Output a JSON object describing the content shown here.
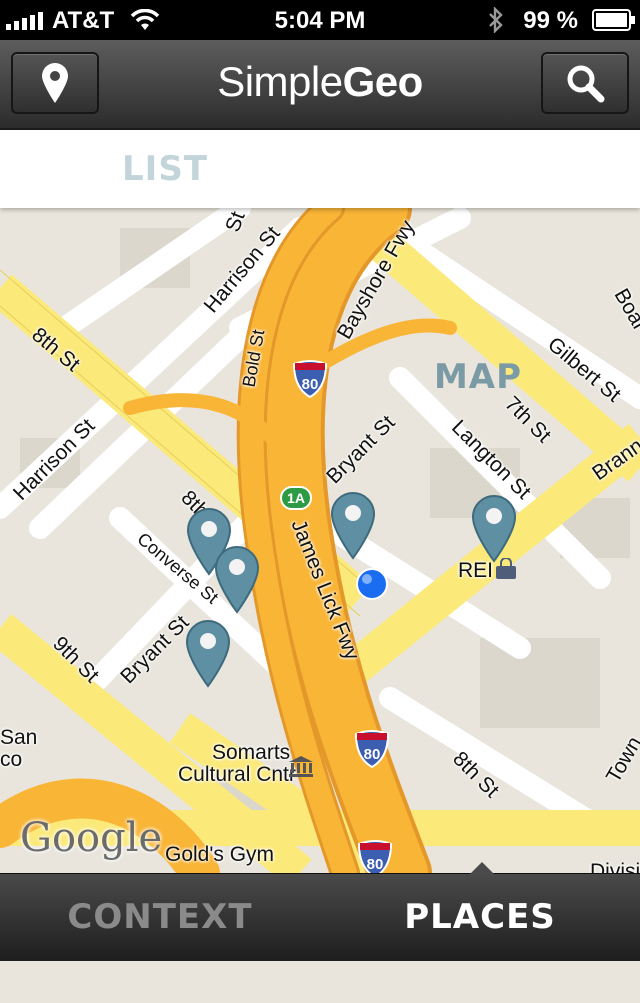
{
  "status_bar": {
    "carrier": "AT&T",
    "time": "5:04 PM",
    "battery": "99 %"
  },
  "nav": {
    "brand_light": "Simple",
    "brand_bold": "Geo",
    "left_icon": "location-pin-icon",
    "right_icon": "search-icon"
  },
  "segments": {
    "list": "LIST",
    "map": "MAP",
    "selected": "MAP"
  },
  "map": {
    "attribution": "Google",
    "streets": {
      "eighth_top": "8th St",
      "harrison_top": "Harrison St",
      "bayshore": "Bayshore Fwy",
      "bold": "Bold St",
      "harrison_left": "Harrison St",
      "eighth_mid": "8th",
      "converse": "Converse St",
      "bryant_left": "Bryant St",
      "ninth": "9th St",
      "bryant_mid": "Bryant St",
      "langton": "Langton St",
      "gilbert": "Gilbert St",
      "seventh": "7th St",
      "brann": "Brann",
      "boar": "Boar",
      "james_lick": "James Lick Fwy",
      "eighth_bottom": "8th St",
      "town": "Town",
      "divisi": "Divisi",
      "top_st": "St",
      "san": "San",
      "co": "co"
    },
    "shields": [
      "80",
      "80",
      "80"
    ],
    "exit_badge": "1A",
    "places": {
      "rei": "REI",
      "somarts_line1": "Somarts",
      "somarts_line2": "Cultural Cntr",
      "golds": "Gold's Gym"
    },
    "pins": [
      "pin-converse-1",
      "pin-converse-2",
      "pin-bryant",
      "pin-center",
      "pin-rei"
    ]
  },
  "tabs": {
    "context": "CONTEXT",
    "places": "PLACES",
    "selected": "PLACES"
  },
  "colors": {
    "freeway": "#f8b536",
    "arterial": "#fbe97a",
    "pin": "#5f8fa3",
    "segment_active": "#7a9aa5",
    "segment_inactive": "#c3d4da",
    "user_dot": "#1a6cf0"
  }
}
